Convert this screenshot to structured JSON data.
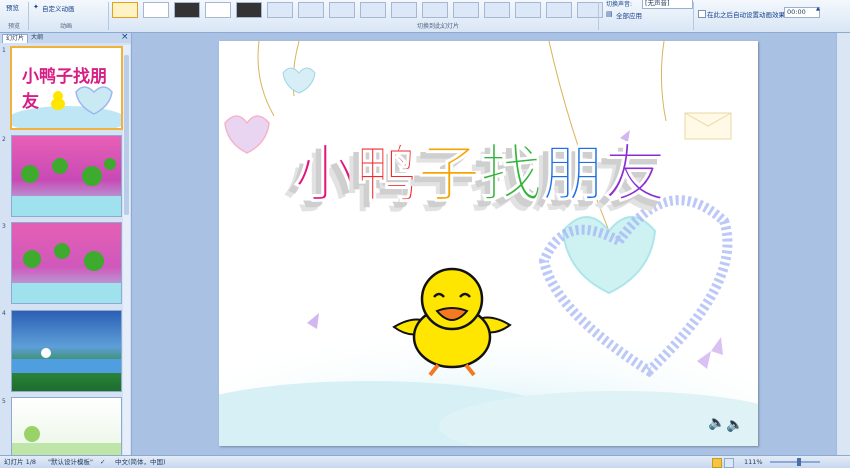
{
  "ribbon": {
    "preview_label": "预览",
    "custom_animation_label": "自定义动画",
    "group_preview": "预览",
    "group_animation": "动画",
    "group_transition": "切换到此幻灯片",
    "sound_label": "切换声音:",
    "sound_value": "[无声音]",
    "apply_all_label": "全部应用",
    "auto_after_label": "在此之后自动设置动画效果:",
    "auto_after_value": "00:00"
  },
  "panel": {
    "tab_slides": "幻灯片",
    "tab_outline": "大纲",
    "close_glyph": "×",
    "thumb1_title": "小鸭子找朋友",
    "slides": [
      "1",
      "2",
      "3",
      "4",
      "5"
    ]
  },
  "slide": {
    "title": "小鸭子找朋友",
    "title_colors": [
      "#e0177a",
      "#f2272a",
      "#f5a300",
      "#34b33c",
      "#1f6fe0",
      "#8a2ed4"
    ]
  },
  "status": {
    "slide_info": "幻灯片 1/8",
    "theme": "\"默认设计模板\"",
    "language": "中文(简体，中国)",
    "zoom": "111%"
  },
  "icons": {
    "sound": "speaker-icon",
    "spellcheck": "check-icon"
  }
}
